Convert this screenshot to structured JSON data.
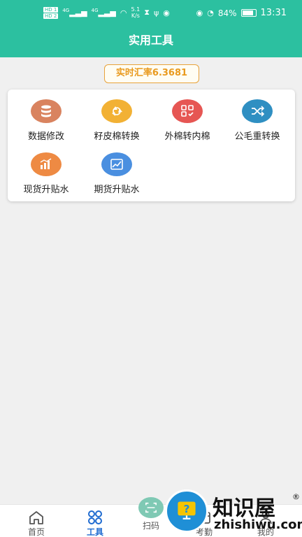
{
  "status_bar": {
    "hd1": "HD 1",
    "hd2": "HD 2",
    "net1": "4G",
    "net2": "4G",
    "speed_value": "5.1",
    "speed_unit": "K/s",
    "battery_percent": "84%",
    "battery_level": 0.84,
    "time": "13:31"
  },
  "header": {
    "title": "实用工具"
  },
  "rate": {
    "label": "实时汇率6.3681"
  },
  "tools": [
    {
      "label": "数据修改",
      "icon": "database-icon",
      "color": "#d9835f"
    },
    {
      "label": "籽皮棉转换",
      "icon": "recycle-icon",
      "color": "#f2b134"
    },
    {
      "label": "外棉转内棉",
      "icon": "grid-check-icon",
      "color": "#e65653"
    },
    {
      "label": "公毛重转换",
      "icon": "shuffle-icon",
      "color": "#2f8fc2"
    },
    {
      "label": "现货升贴水",
      "icon": "bar-chart-icon",
      "color": "#ee8a43"
    },
    {
      "label": "期货升贴水",
      "icon": "line-chart-icon",
      "color": "#4a8fe0"
    }
  ],
  "bottom_nav": {
    "items": [
      {
        "label": "首页",
        "icon": "home-icon"
      },
      {
        "label": "工具",
        "icon": "apps-icon",
        "active": true
      },
      {
        "label": "扫码",
        "icon": "scan-icon"
      },
      {
        "label": "考勤",
        "icon": "attendance-icon"
      },
      {
        "label": "我的",
        "icon": "user-icon"
      }
    ]
  },
  "watermark": {
    "name": "知识屋",
    "domain": "zhishiwu.com",
    "reg": "®"
  },
  "colors": {
    "primary": "#2cc0a0",
    "accent": "#e99a1e",
    "active_nav": "#1f6bd0"
  }
}
